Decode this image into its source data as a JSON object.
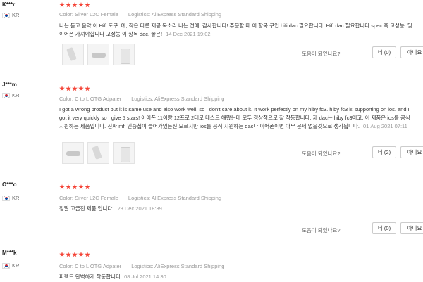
{
  "colors": {
    "star": "#f44336",
    "meta": "#999999",
    "text": "#333333"
  },
  "icons": {
    "rating": "star-icon",
    "country_flag": "korea-flag-icon"
  },
  "helpful_prompt": "도움이 되었나요?",
  "reviews": [
    {
      "user": "K***r",
      "country": "KR",
      "stars": 5,
      "color_label": "Color:",
      "color_value": "Silver L2C Female",
      "logistics_label": "Logistics:",
      "logistics_value": "AliExpress Standard Shipping",
      "text": "나는 듣고 음악 이 Hifi 도구. 예, 작은 다른 제공 목소리 나는 전에. 감사합니다! 주문할 때 이 항목 구입 hifi dac 필요합니다. Hifi dac 필요합니다 spec 즉 고성능. 및 이어폰 가져야합니다 고성능 이 항목 dac. 좋은!",
      "date": "14 Dec 2021 19:02",
      "yes_label": "네 (0)",
      "no_label": "아니요"
    },
    {
      "user": "J***m",
      "country": "KR",
      "stars": 5,
      "color_label": "Color:",
      "color_value": "C to L OTG Adpater",
      "logistics_label": "Logistics:",
      "logistics_value": "AliExpress Standard Shipping",
      "text": "I got a wrong product but it is same use and also work well. so I don't care about it. It work perfectly on my hiby fc3. hiby fc3 is supporting on ios. and I got it very quickly so I give 5 stars! 아이폰 11이랑 12프로 2대로 테스트 해봤는데 모두 정상적으로 잘 작동합니다. 제 dac는 hiby fc3이고, 이 제품은 ios를 공식 지원하는 제품입니다. 진짜 mfi 인증칩이 들어가있는진 모르지만 ios를 공식 지원하는 dac나 이어폰이면 아무 문제 없을것으로 생각됩니다.",
      "date": "01 Aug 2021 07:11",
      "yes_label": "네 (2)",
      "no_label": "아니요"
    },
    {
      "user": "O***o",
      "country": "KR",
      "stars": 5,
      "color_label": "Color:",
      "color_value": "Silver L2C Female",
      "logistics_label": "Logistics:",
      "logistics_value": "AliExpress Standard Shipping",
      "text": "정말 고급진 제품 입니다.",
      "date": "23 Dec 2021 18:39",
      "yes_label": "네 (0)",
      "no_label": "아니요"
    },
    {
      "user": "M***k",
      "country": "KR",
      "stars": 5,
      "color_label": "Color:",
      "color_value": "C to L OTG Adpater",
      "logistics_label": "Logistics:",
      "logistics_value": "AliExpress Standard Shipping",
      "text": "퍼펙트 완벽하게 작동합니다",
      "date": "08 Jul 2021 14:30"
    }
  ]
}
